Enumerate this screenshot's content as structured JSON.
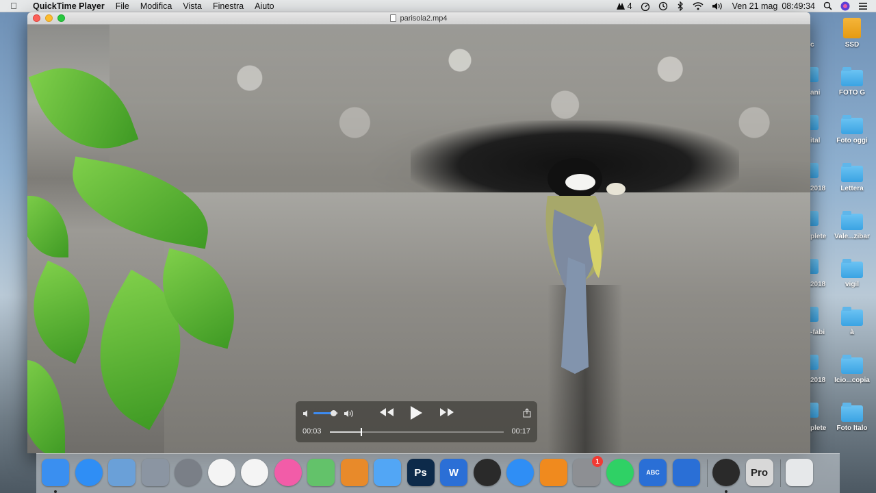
{
  "menubar": {
    "app_name": "QuickTime Player",
    "menus": [
      "File",
      "Modifica",
      "Vista",
      "Finestra",
      "Aiuto"
    ],
    "input_indicator": "4",
    "date": "Ven 21 mag",
    "time": "08:49:34"
  },
  "window": {
    "title": "parisola2.mp4"
  },
  "player": {
    "current_time": "00:03",
    "end_time": "00:17",
    "progress_fraction": 0.18,
    "volume_fraction": 0.8
  },
  "desktop": {
    "items": [
      {
        "label": "SSD",
        "kind": "disk"
      },
      {
        "label": "FOTO G",
        "kind": "folder"
      },
      {
        "label": "Foto oggi",
        "kind": "folder"
      },
      {
        "label": "Lettera",
        "kind": "folder"
      },
      {
        "label": "Vale...zibar",
        "kind": "folder"
      },
      {
        "label": "vigil",
        "kind": "folder"
      },
      {
        "label": "à",
        "kind": "folder"
      },
      {
        "label": "Icio...copia",
        "kind": "folder"
      },
      {
        "label": "Foto Italo",
        "kind": "folder"
      }
    ],
    "partial_labels": [
      "c",
      "ani",
      "ital",
      "2018",
      "plete",
      "2018",
      "-fabi",
      "2018",
      "plete"
    ]
  },
  "dock": {
    "apps": [
      {
        "name": "finder-icon",
        "label": "",
        "color": "#3a8ff0"
      },
      {
        "name": "safari-icon",
        "label": "",
        "color": "#2f8ef5"
      },
      {
        "name": "preview-bird-icon",
        "label": "",
        "color": "#6aa0d8"
      },
      {
        "name": "image-capture-icon",
        "label": "",
        "color": "#8b95a2"
      },
      {
        "name": "launchpad-icon",
        "label": "",
        "color": "#7a7f87"
      },
      {
        "name": "photos-icon",
        "label": "",
        "color": "#f4f4f4"
      },
      {
        "name": "chrome-icon",
        "label": "",
        "color": "#f4f4f4"
      },
      {
        "name": "itunes-icon",
        "label": "",
        "color": "#f25ca8"
      },
      {
        "name": "maps-icon",
        "label": "",
        "color": "#63c26a"
      },
      {
        "name": "calculator-icon",
        "label": "",
        "color": "#e88a2a"
      },
      {
        "name": "messages-icon",
        "label": "",
        "color": "#52a6f5"
      },
      {
        "name": "photoshop-icon",
        "label": "Ps",
        "color": "#0d2a4a"
      },
      {
        "name": "word-icon",
        "label": "W",
        "color": "#2b6fd6"
      },
      {
        "name": "camera-icon",
        "label": "",
        "color": "#2a2a2a"
      },
      {
        "name": "app-store-icon",
        "label": "",
        "color": "#2f8ef5"
      },
      {
        "name": "vlc-icon",
        "label": "",
        "color": "#f08a1e"
      },
      {
        "name": "system-preferences-icon",
        "label": "",
        "color": "#8d8f93",
        "badge": "1"
      },
      {
        "name": "whatsapp-icon",
        "label": "",
        "color": "#2fd165"
      },
      {
        "name": "add-photo-icon",
        "label": "ABC",
        "color": "#2a6fd6"
      },
      {
        "name": "add-contact-icon",
        "label": "",
        "color": "#2a6fd6"
      },
      {
        "name": "quicktime-icon",
        "label": "",
        "color": "#2a2a2a"
      },
      {
        "name": "pro-app-icon",
        "label": "Pro",
        "color": "#d8d8d8"
      },
      {
        "name": "trash-icon",
        "label": "",
        "color": "#e6e8ea"
      }
    ]
  }
}
